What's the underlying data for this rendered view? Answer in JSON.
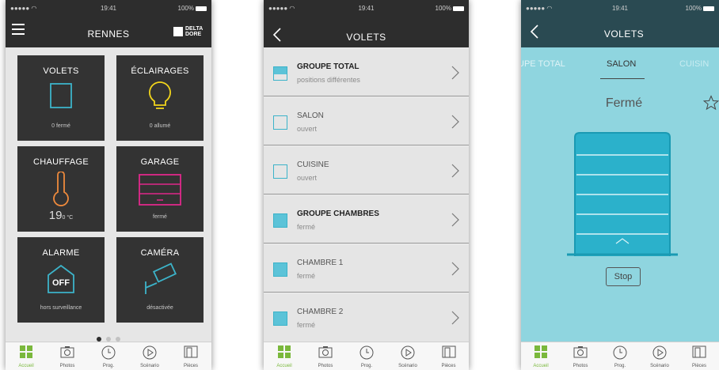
{
  "status": {
    "time": "19:41",
    "battery": "100%",
    "signal": "●●●●● ◠"
  },
  "screen1": {
    "title": "RENNES",
    "logo": {
      "line1": "DELTA",
      "line2": "DORE"
    },
    "tiles": [
      {
        "title": "VOLETS",
        "status": "0 fermé"
      },
      {
        "title": "ÉCLAIRAGES",
        "status": "0 allumé"
      },
      {
        "title": "CHAUFFAGE",
        "temp": "19",
        "unit": "0 °C"
      },
      {
        "title": "GARAGE",
        "status": "fermé"
      },
      {
        "title": "ALARME",
        "status": "hors surveillance",
        "badge": "OFF"
      },
      {
        "title": "CAMÉRA",
        "status": "désactivée"
      }
    ],
    "pager": {
      "pages": 3,
      "active": 0
    }
  },
  "screen2": {
    "title": "VOLETS",
    "rows": [
      {
        "name": "GROUPE TOTAL",
        "state": "positions différentes",
        "bold": true,
        "icon": "half"
      },
      {
        "name": "SALON",
        "state": "ouvert",
        "bold": false,
        "icon": "empty"
      },
      {
        "name": "CUISINE",
        "state": "ouvert",
        "bold": false,
        "icon": "empty"
      },
      {
        "name": "GROUPE CHAMBRES",
        "state": "fermé",
        "bold": true,
        "icon": "full"
      },
      {
        "name": "CHAMBRE 1",
        "state": "fermé",
        "bold": false,
        "icon": "full"
      },
      {
        "name": "CHAMBRE 2",
        "state": "fermé",
        "bold": false,
        "icon": "full"
      }
    ]
  },
  "screen3": {
    "title": "VOLETS",
    "tabs": [
      "UPE TOTAL",
      "SALON",
      "CUISIN"
    ],
    "active_tab": 1,
    "state": "Fermé",
    "stop_label": "Stop"
  },
  "tabbar": [
    {
      "label": "Accueil",
      "icon": "home-grid-icon"
    },
    {
      "label": "Photos",
      "icon": "camera-icon"
    },
    {
      "label": "Prog.",
      "icon": "clock-icon"
    },
    {
      "label": "Scénario",
      "icon": "play-icon"
    },
    {
      "label": "Pièces",
      "icon": "door-icon"
    }
  ],
  "colors": {
    "accent": "#3cb3c9",
    "green": "#7ab83c",
    "yellow": "#f2d51b",
    "orange": "#ef8a3c",
    "magenta": "#e0288a",
    "dark": "#2d2d2d",
    "detail_bg": "#8fd5df"
  }
}
